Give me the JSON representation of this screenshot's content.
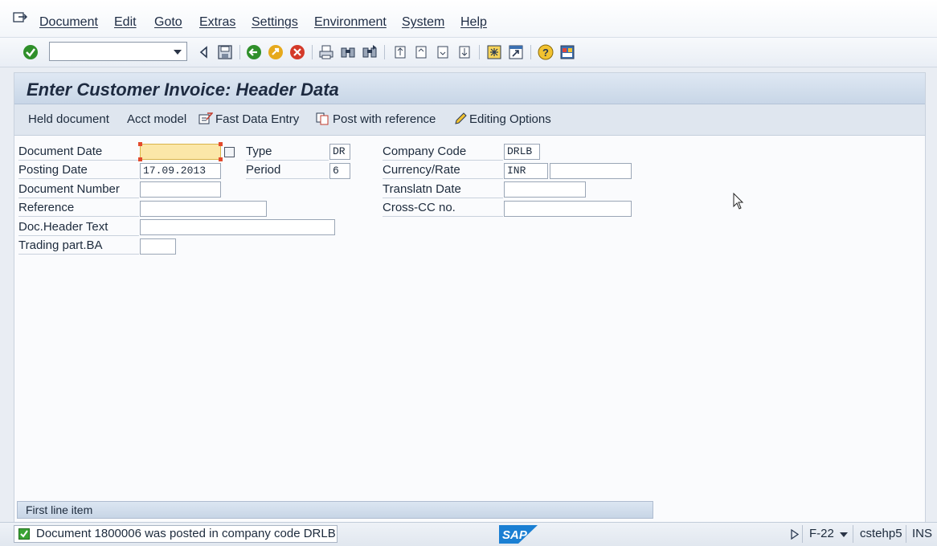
{
  "menubar": {
    "items": [
      "Document",
      "Edit",
      "Goto",
      "Extras",
      "Settings",
      "Environment",
      "System",
      "Help"
    ]
  },
  "toolbar": {
    "command_value": "",
    "icons": [
      "enter-icon",
      "back-arrow-icon",
      "save-icon",
      "back-icon",
      "exit-icon",
      "cancel-icon",
      "print-icon",
      "find-icon",
      "find-next-icon",
      "first-page-icon",
      "previous-page-icon",
      "next-page-icon",
      "last-page-icon",
      "create-session-icon",
      "shortcut-icon",
      "help-icon",
      "customize-layout-icon"
    ]
  },
  "title": "Enter Customer Invoice: Header Data",
  "appbar": {
    "held_document": "Held document",
    "acct_model": "Acct model",
    "fast_data_entry": "Fast Data Entry",
    "post_with_reference": "Post with reference",
    "editing_options": "Editing Options"
  },
  "form": {
    "document_date": {
      "label": "Document Date",
      "value": ""
    },
    "posting_date": {
      "label": "Posting Date",
      "value": "17.09.2013"
    },
    "document_number": {
      "label": "Document Number",
      "value": ""
    },
    "reference": {
      "label": "Reference",
      "value": ""
    },
    "doc_header_text": {
      "label": "Doc.Header Text",
      "value": ""
    },
    "trading_part_ba": {
      "label": "Trading part.BA",
      "value": ""
    },
    "type": {
      "label": "Type",
      "value": "DR"
    },
    "period": {
      "label": "Period",
      "value": "6"
    },
    "company_code": {
      "label": "Company Code",
      "value": "DRLB"
    },
    "currency_rate": {
      "label": "Currency/Rate",
      "value": "INR",
      "rate": ""
    },
    "translatn_date": {
      "label": "Translatn Date",
      "value": ""
    },
    "cross_cc_no": {
      "label": "Cross-CC no.",
      "value": ""
    }
  },
  "first_line_item": "First line item",
  "status": {
    "message": "Document 1800006 was posted in company code DRLB",
    "transaction": "F-22",
    "server": "cstehp5",
    "mode": "INS"
  },
  "colors": {
    "accent": "#c8d6e7",
    "focus_field": "#fbe7a8",
    "success": "#3aa335"
  }
}
